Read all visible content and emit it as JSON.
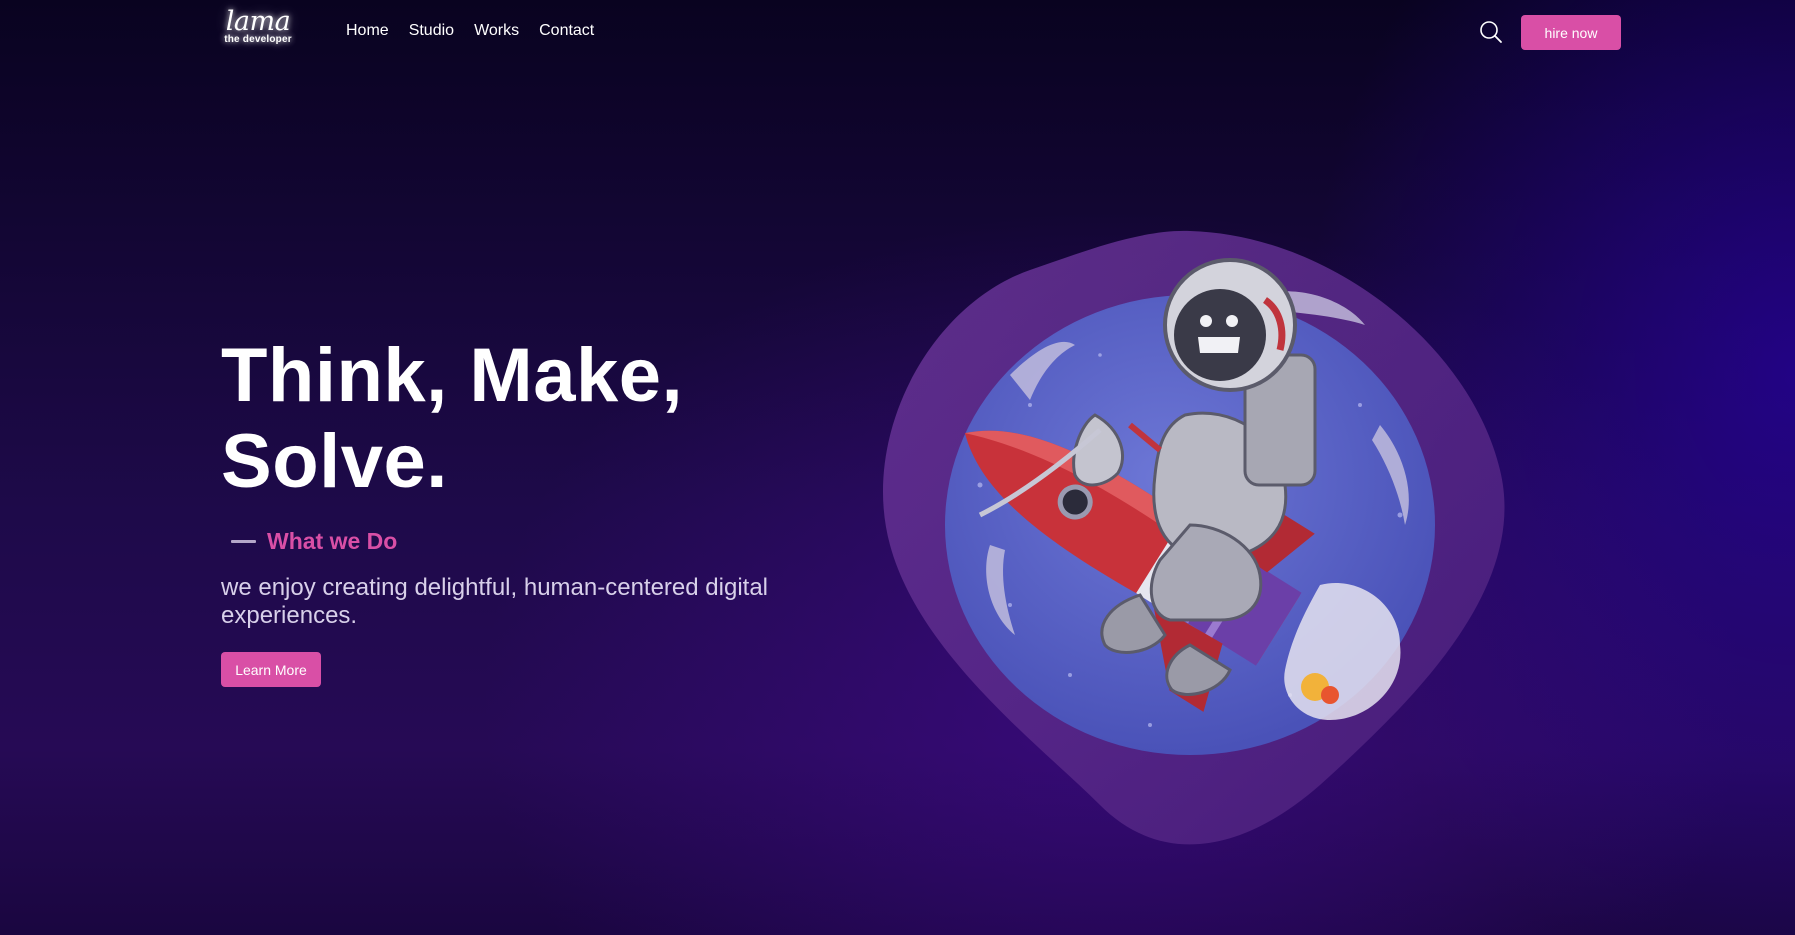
{
  "nav": {
    "logo": {
      "main": "lama",
      "sub": "the developer"
    },
    "links": [
      "Home",
      "Studio",
      "Works",
      "Contact"
    ],
    "search_icon": "search-icon",
    "hire_label": "hire now"
  },
  "hero": {
    "title_line1": "Think, Make,",
    "title_line2": "Solve.",
    "subtitle": "What we Do",
    "description": "we enjoy creating delightful, human-centered digital experiences.",
    "cta_label": "Learn More"
  },
  "illustration": {
    "icon": "astronaut-riding-rocket-illustration",
    "blob_color": "#5c2a8e",
    "planet_color": "#5560c6"
  },
  "colors": {
    "accent": "#d94fa6",
    "text": "#ffffff",
    "muted_text": "#d8d0ea",
    "background_dark": "#0a0322",
    "background_purple": "#260a55"
  }
}
